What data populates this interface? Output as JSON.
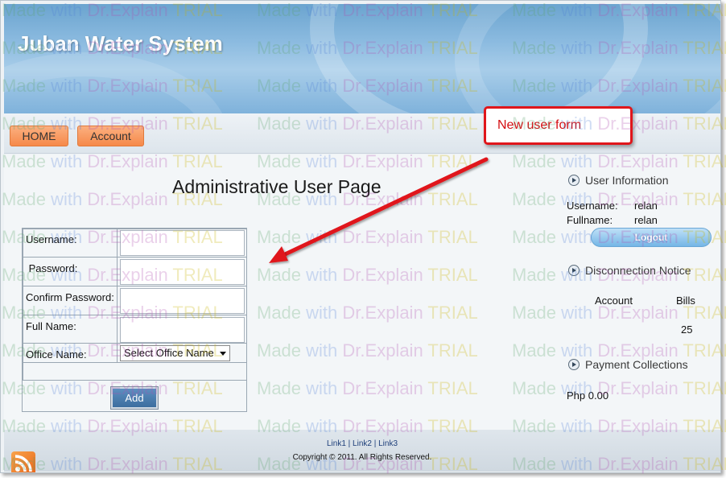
{
  "site": {
    "title": "Juban Water System"
  },
  "nav": {
    "items": [
      {
        "label": "HOME"
      },
      {
        "label": "Account"
      }
    ]
  },
  "main": {
    "page_title": "Administrative User Page",
    "form": {
      "username_label": "Username:",
      "password_label": " Password:",
      "confirm_password_label": "Confirm Password:",
      "full_name_label": "Full Name:",
      "office_name_label": "Office Name:",
      "office_select_value": "Select Office Name",
      "add_button": "Add"
    }
  },
  "sidebar": {
    "user_info": {
      "heading": "User Information",
      "username_label": "Username:",
      "username_value": "relan",
      "fullname_label": "Fullname:",
      "fullname_value": "relan",
      "logout_button": "Logout"
    },
    "disconnection": {
      "heading": "Disconnection Notice",
      "col_account": "Account",
      "col_bills": "Bills",
      "bills_value": "25"
    },
    "payments": {
      "heading": "Payment Collections",
      "amount": "Php 0.00"
    }
  },
  "footer": {
    "link1": "Link1",
    "link2": "Link2",
    "link3": "Link3",
    "separator": " | ",
    "copyright": "Copyright © 2011. All Rights Reserved."
  },
  "annotation": {
    "callout": "New user form",
    "color": "#e0161b"
  },
  "watermark": {
    "made": "Made ",
    "with": "with ",
    "dr": "Dr.Explain ",
    "trial": "TRIAL"
  },
  "colors": {
    "nav_button": "#f6894a",
    "add_button": "#3c6e9f",
    "logout_button": "#74b6e6"
  }
}
